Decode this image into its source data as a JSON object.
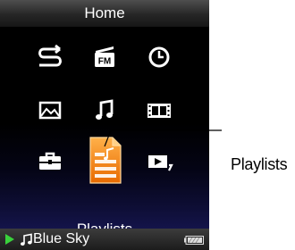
{
  "header": {
    "title": "Home"
  },
  "menu": {
    "items": [
      {
        "label": "Shuffle All",
        "icon": "shuffle-icon"
      },
      {
        "label": "FM Radio",
        "icon": "fm-radio-icon",
        "icon_text": "FM"
      },
      {
        "label": "Clock",
        "icon": "clock-icon"
      },
      {
        "label": "Photo",
        "icon": "photo-icon"
      },
      {
        "label": "Music",
        "icon": "music-note-icon"
      },
      {
        "label": "Video",
        "icon": "film-icon"
      },
      {
        "label": "Settings",
        "icon": "toolbox-icon"
      },
      {
        "label": "Playlists",
        "icon": "playlist-icon"
      },
      {
        "label": "Now Playing",
        "icon": "now-playing-icon"
      }
    ],
    "selected_label": "Playlists"
  },
  "status": {
    "track": "Blue Sky",
    "play_icon": "play-icon",
    "note_icon": "music-note-icon",
    "battery_icon": "battery-icon"
  },
  "callout": {
    "label": "Playlists"
  },
  "colors": {
    "highlight": "#f07800",
    "status_play": "#39d23c",
    "background": "#000000"
  }
}
